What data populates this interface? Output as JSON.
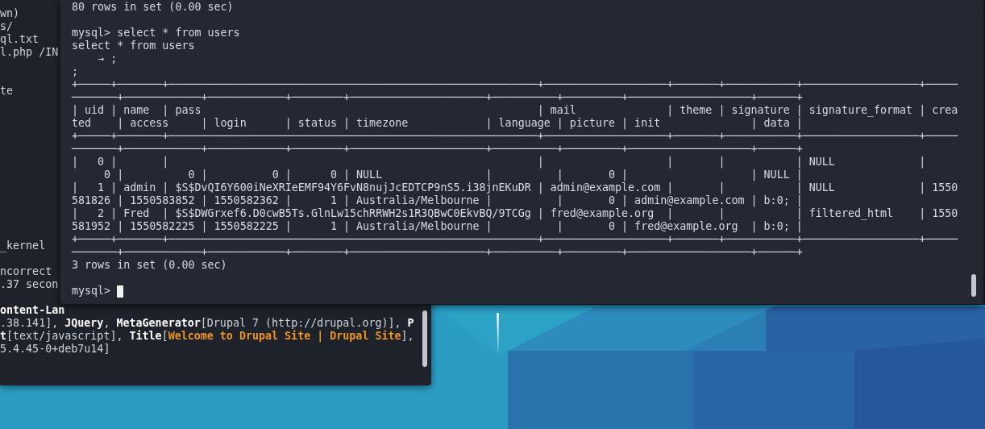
{
  "background_terminal": {
    "lines": [
      {
        "kind": "text",
        "segments": [
          {
            "kind": "plain",
            "text": "wn)"
          }
        ]
      },
      {
        "kind": "text",
        "segments": [
          {
            "kind": "plain",
            "text": "s/"
          }
        ]
      },
      {
        "kind": "text",
        "segments": [
          {
            "kind": "plain",
            "text": "ql.txt"
          }
        ]
      },
      {
        "kind": "text",
        "segments": [
          {
            "kind": "plain",
            "text": "l.php /IN"
          }
        ]
      },
      {
        "kind": "blank"
      },
      {
        "kind": "blank"
      },
      {
        "kind": "text",
        "segments": [
          {
            "kind": "plain",
            "text": "te"
          }
        ]
      },
      {
        "kind": "blank"
      },
      {
        "kind": "blank"
      },
      {
        "kind": "blank"
      },
      {
        "kind": "blank"
      },
      {
        "kind": "blank"
      },
      {
        "kind": "blank"
      },
      {
        "kind": "blank"
      },
      {
        "kind": "blank"
      },
      {
        "kind": "blank"
      },
      {
        "kind": "blank"
      },
      {
        "kind": "blank"
      },
      {
        "kind": "text",
        "segments": [
          {
            "kind": "plain",
            "text": "_kernel"
          }
        ]
      },
      {
        "kind": "blank"
      },
      {
        "kind": "text",
        "segments": [
          {
            "kind": "plain",
            "text": "ncorrect"
          }
        ]
      },
      {
        "kind": "text",
        "segments": [
          {
            "kind": "plain",
            "text": ".37 secon"
          }
        ]
      },
      {
        "kind": "blank"
      },
      {
        "kind": "text",
        "segments": [
          {
            "kind": "bold",
            "text": "ontent-Lan"
          }
        ]
      },
      {
        "kind": "text",
        "segments": [
          {
            "kind": "plain",
            "text": ".38.141], "
          },
          {
            "kind": "bold",
            "text": "JQuery"
          },
          {
            "kind": "plain",
            "text": ", "
          },
          {
            "kind": "bold",
            "text": "MetaGenerator"
          },
          {
            "kind": "plain",
            "text": "[Drupal 7 (http://drupal.org)], "
          },
          {
            "kind": "bold",
            "text": "P"
          }
        ]
      },
      {
        "kind": "text",
        "segments": [
          {
            "kind": "bold",
            "text": "t"
          },
          {
            "kind": "plain",
            "text": "[text/javascript], "
          },
          {
            "kind": "bold",
            "text": "Title"
          },
          {
            "kind": "plain",
            "text": "["
          },
          {
            "kind": "title",
            "text": "Welcome to Drupal Site | Drupal Site"
          },
          {
            "kind": "plain",
            "text": "],"
          }
        ]
      },
      {
        "kind": "text",
        "segments": [
          {
            "kind": "plain",
            "text": "5.4.45-0+deb7u14]"
          }
        ]
      }
    ]
  },
  "mysql_terminal": {
    "lines": [
      {
        "kind": "text",
        "text": "80 rows in set (0.00 sec)"
      },
      {
        "kind": "blank"
      },
      {
        "kind": "text",
        "text": "mysql> select * from users"
      },
      {
        "kind": "text",
        "text": "select * from users"
      },
      {
        "kind": "text",
        "text": "    → ;"
      },
      {
        "kind": "text",
        "text": ";"
      },
      {
        "kind": "text",
        "text": "+─────+───────+─────────────────────────────────────────────────────────+───────────────────+───────+───────────+──────────────────+─────"
      },
      {
        "kind": "text",
        "text": "───────+────────────+────────────+────────+─────────────────────+──────────+─────────+───────────────────+──────+"
      },
      {
        "kind": "text",
        "text": "| uid | name  | pass                                                    | mail              | theme | signature | signature_format | crea"
      },
      {
        "kind": "text",
        "text": "ted    | access     | login      | status | timezone            | language | picture | init              | data |"
      },
      {
        "kind": "text",
        "text": "+─────+───────+─────────────────────────────────────────────────────────+───────────────────+───────+───────────+──────────────────+─────"
      },
      {
        "kind": "text",
        "text": "───────+────────────+────────────+────────+─────────────────────+──────────+─────────+───────────────────+──────+"
      },
      {
        "kind": "text",
        "text": "|   0 |       |                                                         |                   |       |           | NULL             |"
      },
      {
        "kind": "text",
        "text": "     0 |          0 |          0 |      0 | NULL                |          |       0 |                   | NULL |"
      },
      {
        "kind": "text",
        "text": "|   1 | admin | $S$DvQI6Y600iNeXRIeEMF94Y6FvN8nujJcEDTCP9nS5.i38jnEKuDR | admin@example.com |       |           | NULL             | 1550"
      },
      {
        "kind": "text",
        "text": "581826 | 1550583852 | 1550582362 |      1 | Australia/Melbourne |          |       0 | admin@example.com | b:0; |"
      },
      {
        "kind": "text",
        "text": "|   2 | Fred  | $S$DWGrxef6.D0cwB5Ts.GlnLw15chRRWH2s1R3QBwC0EkvBQ/9TCGg | fred@example.org  |       |           | filtered_html    | 1550"
      },
      {
        "kind": "text",
        "text": "581952 | 1550582225 | 1550582225 |      1 | Australia/Melbourne |          |       0 | fred@example.org  | b:0; |"
      },
      {
        "kind": "text",
        "text": "+─────+───────+─────────────────────────────────────────────────────────+───────────────────+───────+───────────+──────────────────+─────"
      },
      {
        "kind": "text",
        "text": "───────+────────────+────────────+────────+─────────────────────+──────────+─────────+───────────────────+──────+"
      },
      {
        "kind": "text",
        "text": "3 rows in set (0.00 sec)"
      },
      {
        "kind": "blank"
      },
      {
        "kind": "prompt",
        "text": "mysql>"
      }
    ]
  }
}
